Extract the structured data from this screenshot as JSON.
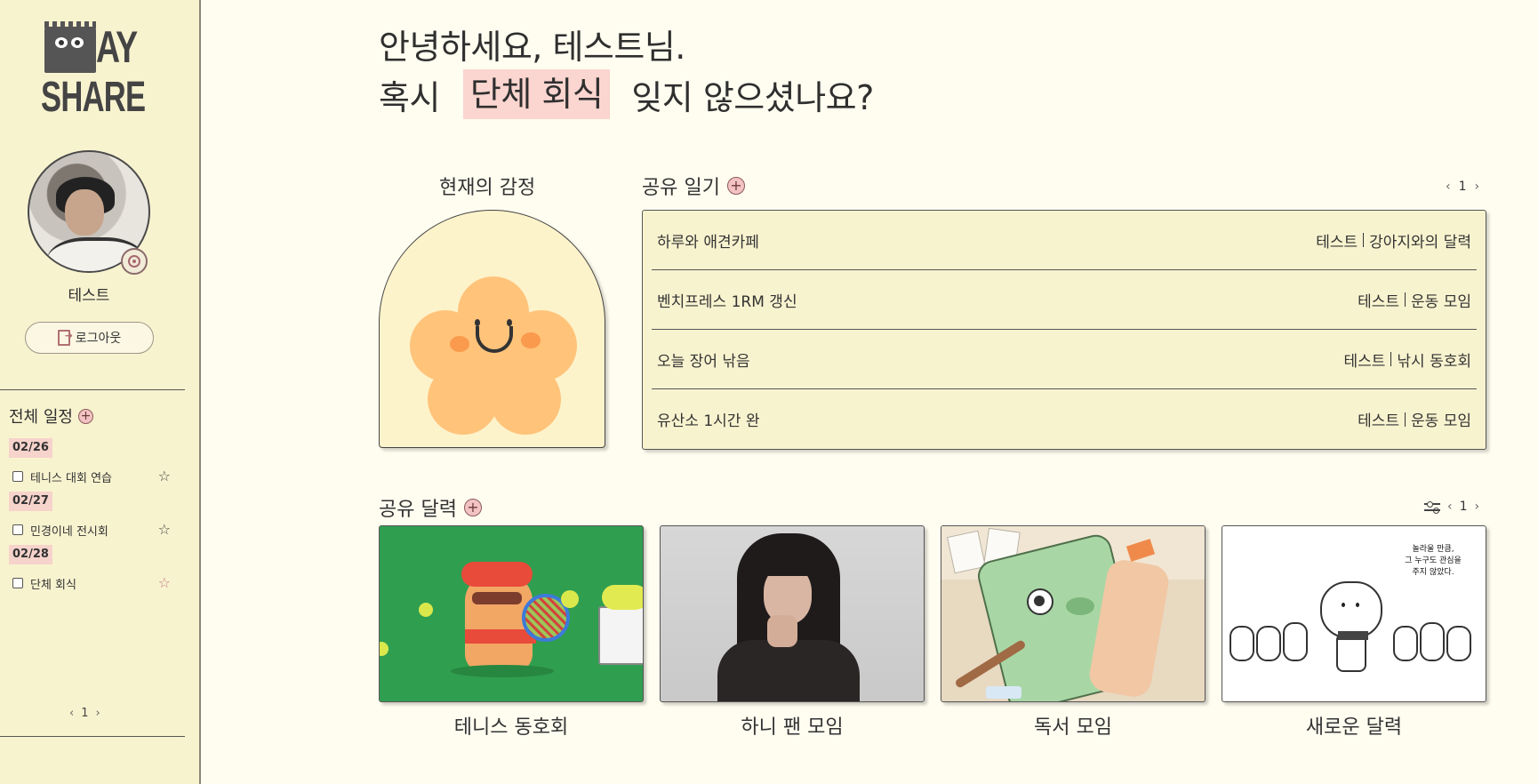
{
  "app": {
    "logo_text_top": "AY",
    "logo_text_bottom": "SHARE"
  },
  "sidebar": {
    "username": "테스트",
    "logout_label": "로그아웃",
    "schedule_title": "전체 일정",
    "schedule": [
      {
        "date": "02/26",
        "title": "테니스 대회 연습",
        "starred": false
      },
      {
        "date": "02/27",
        "title": "민경이네 전시회",
        "starred": false
      },
      {
        "date": "02/28",
        "title": "단체 회식",
        "starred": true
      }
    ],
    "page": "1"
  },
  "greeting": {
    "line1": "안녕하세요, 테스트님.",
    "line2_prefix": "혹시",
    "event": "단체 회식",
    "line2_suffix": "잊지 않으셨나요?"
  },
  "emotion": {
    "title": "현재의 감정",
    "icon": "smiling-flower-icon"
  },
  "diary": {
    "title": "공유 일기",
    "page": "1",
    "items": [
      {
        "title": "하루와 애견카페",
        "author": "테스트",
        "calendar": "강아지와의 달력"
      },
      {
        "title": "벤치프레스 1RM 갱신",
        "author": "테스트",
        "calendar": "운동 모임"
      },
      {
        "title": "오늘 장어 낚음",
        "author": "테스트",
        "calendar": "낚시 동호회"
      },
      {
        "title": "유산소 1시간 완",
        "author": "테스트",
        "calendar": "운동 모임"
      }
    ]
  },
  "calendars": {
    "title": "공유 달력",
    "page": "1",
    "items": [
      {
        "name": "테니스 동호회",
        "thumb": "tennis-character-illustration"
      },
      {
        "name": "하니 팬 모임",
        "thumb": "person-photo"
      },
      {
        "name": "독서 모임",
        "thumb": "reading-character-illustration"
      },
      {
        "name": "새로운 달력",
        "thumb": "cloud-character-illustration",
        "thumb_text": [
          "놀라울 만큼,",
          "그 누구도 관심을",
          "주지 않았다."
        ]
      }
    ]
  },
  "colors": {
    "background": "#fffdf0",
    "sidebar": "#f8f3cf",
    "highlight": "#fbd5cf",
    "accent_pink": "#f3c2c2"
  }
}
